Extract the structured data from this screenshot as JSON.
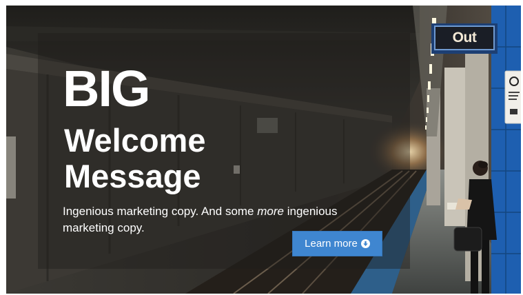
{
  "hero": {
    "headline_big": "BIG",
    "headline_line2": "Welcome",
    "headline_line3": "Message",
    "tagline_before": "Ingenious marketing copy. And some ",
    "tagline_emphasis": "more",
    "tagline_after": " ingenious marketing copy.",
    "cta_label": "Learn more",
    "cta_icon": "arrow-circle-down-icon",
    "cta_color": "#3f86d0"
  },
  "background_photo": {
    "sign_text": "Out",
    "accent_tile_color": "#1e5fb0"
  }
}
